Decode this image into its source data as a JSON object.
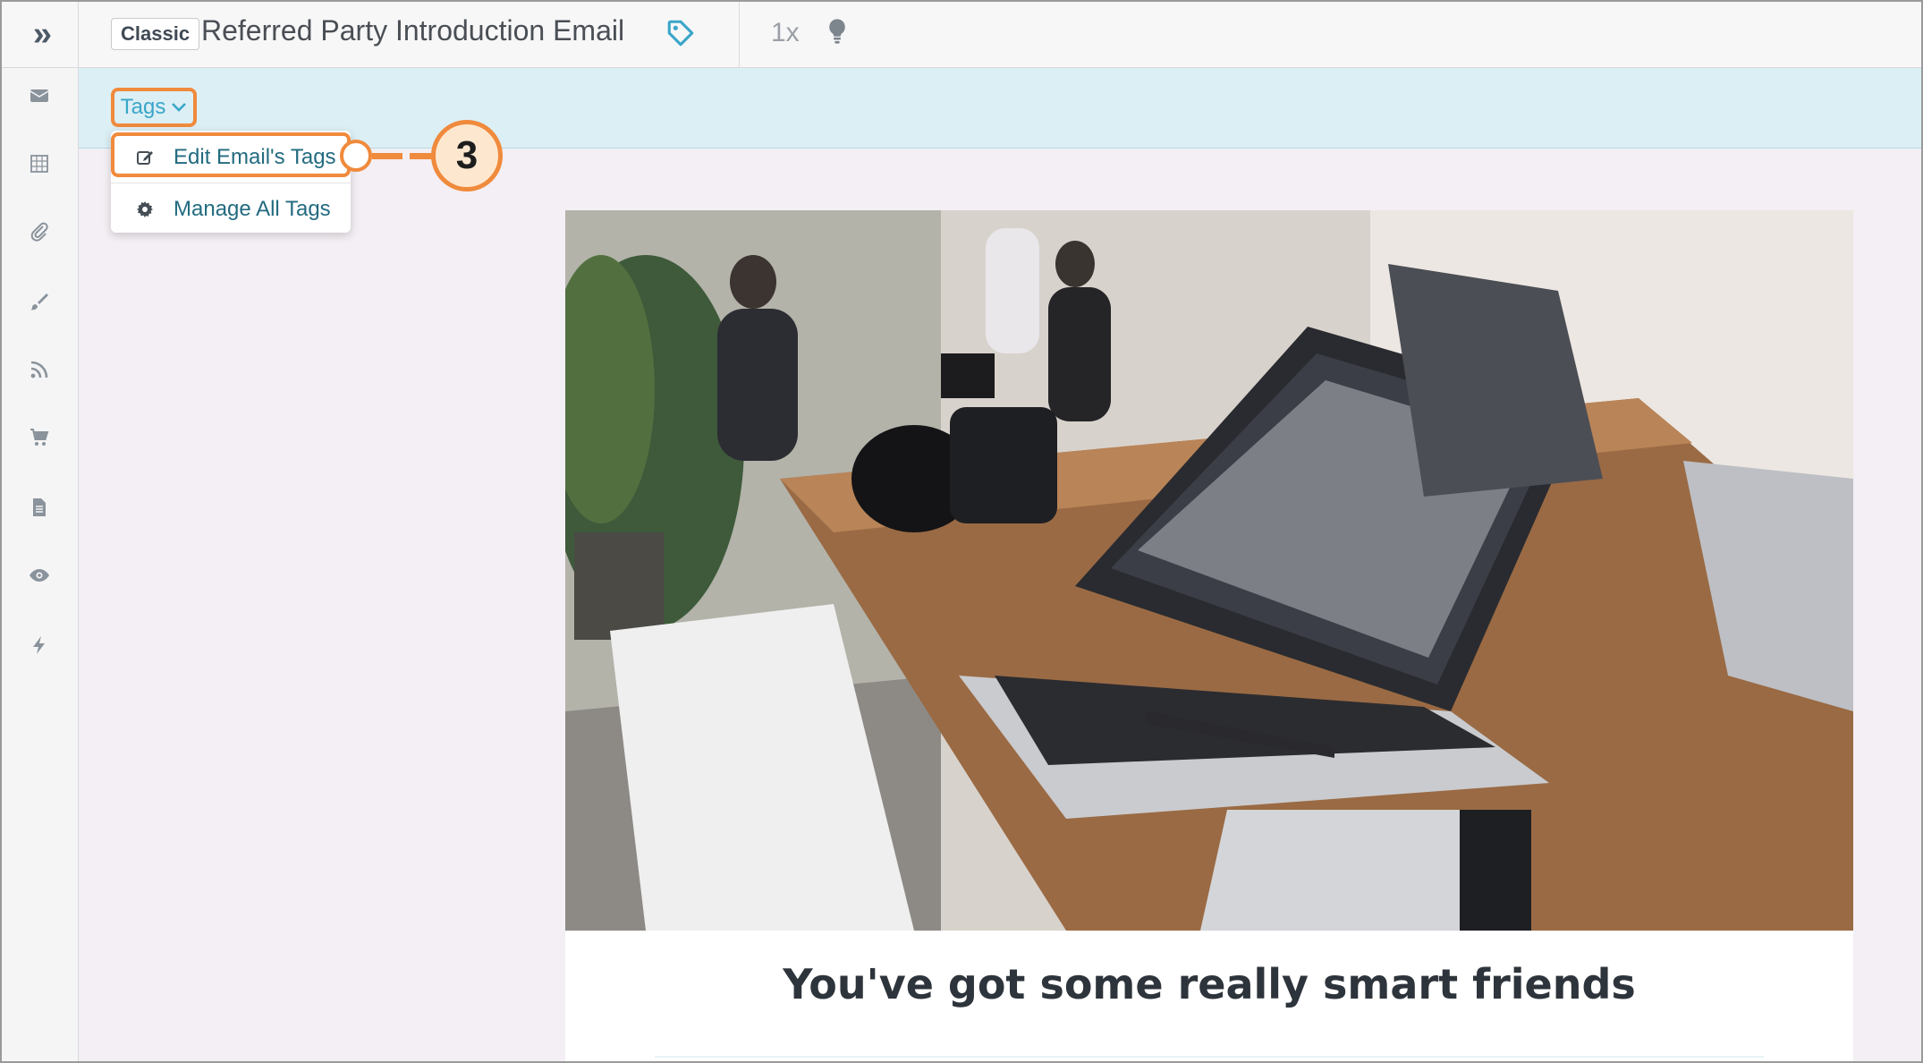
{
  "header": {
    "expand_glyph": "»",
    "mode_badge": "Classic",
    "title": "Referred Party Introduction Email",
    "zoom": "1x",
    "icons": [
      "double-chevron-right-icon",
      "tag-icon",
      "lightbulb-icon"
    ]
  },
  "sidebar": {
    "items": [
      {
        "icon": "envelope-icon"
      },
      {
        "icon": "grid-icon"
      },
      {
        "icon": "paperclip-icon"
      },
      {
        "icon": "brush-icon"
      },
      {
        "icon": "rss-icon"
      },
      {
        "icon": "cart-icon"
      },
      {
        "icon": "document-icon"
      },
      {
        "icon": "eye-icon"
      },
      {
        "icon": "bolt-icon"
      }
    ]
  },
  "tags": {
    "toggle_label": "Tags",
    "menu": [
      {
        "label": "Edit Email's Tags",
        "icon": "edit-icon"
      },
      {
        "label": "Manage All Tags",
        "icon": "gear-icon"
      }
    ]
  },
  "callout": {
    "number": "3"
  },
  "email": {
    "headline": "You've got some really smart friends"
  },
  "colors": {
    "accent": "#f08a3c",
    "tags_band": "#dceff5",
    "link": "#236b80",
    "canvas": "#f3eff4"
  }
}
